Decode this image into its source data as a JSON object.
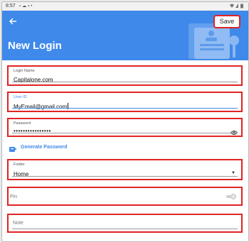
{
  "status_bar": {
    "time": "8:57",
    "left_icons": [
      "gallery-icon",
      "cloud-icon",
      "a-icon",
      "dot-icon"
    ],
    "right_icons": [
      "wifi-icon",
      "signal-icon",
      "battery-icon"
    ]
  },
  "header": {
    "title": "New Login",
    "save_label": "Save",
    "color": "#3f89ea"
  },
  "form": {
    "login_name": {
      "label": "Login Name",
      "value": "Capitalone.com"
    },
    "user_id": {
      "label": "User ID",
      "value": "MyEmail@gmail.com"
    },
    "password": {
      "label": "Password",
      "value": "••••••••••••••••"
    },
    "generate_password_label": "Generate Password",
    "folder": {
      "label": "Folder",
      "value": "Home"
    },
    "pin": {
      "label": "Pin",
      "enabled": false
    },
    "note": {
      "label": "Note"
    }
  },
  "colors": {
    "accent": "#3f89ea",
    "highlight": "#e02424"
  }
}
